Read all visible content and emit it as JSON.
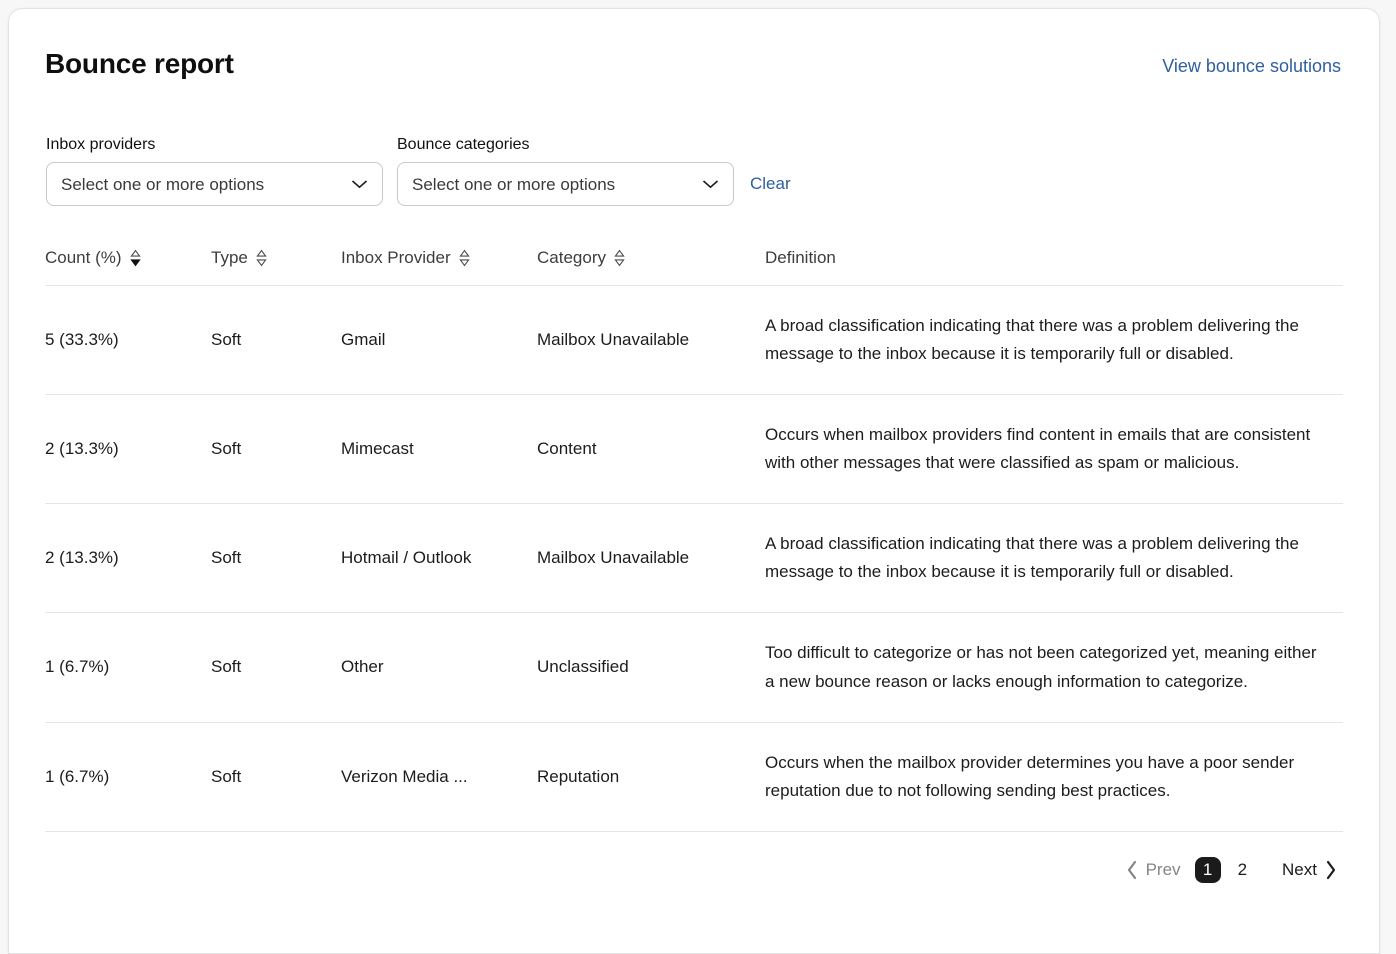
{
  "header": {
    "title": "Bounce report",
    "link_label": "View bounce solutions"
  },
  "filters": {
    "inbox_providers": {
      "label": "Inbox providers",
      "value": "Select one or more options",
      "placeholder": "Select one or more options"
    },
    "bounce_categories": {
      "label": "Bounce categories",
      "value": "Select one or more options",
      "placeholder": "Select one or more options"
    },
    "clear_label": "Clear"
  },
  "table": {
    "columns": [
      {
        "label": "Count (%)",
        "sortable": true,
        "sort_state": "desc"
      },
      {
        "label": "Type",
        "sortable": true,
        "sort_state": "none"
      },
      {
        "label": "Inbox Provider",
        "sortable": true,
        "sort_state": "none"
      },
      {
        "label": "Category",
        "sortable": true,
        "sort_state": "none"
      },
      {
        "label": "Definition",
        "sortable": false,
        "sort_state": "none"
      }
    ],
    "rows": [
      {
        "count": "5 (33.3%)",
        "type": "Soft",
        "provider": "Gmail",
        "category": "Mailbox Unavailable",
        "definition": "A broad classification indicating that there was a problem delivering the message to the inbox because it is temporarily full or disabled."
      },
      {
        "count": "2 (13.3%)",
        "type": "Soft",
        "provider": "Mimecast",
        "category": "Content",
        "definition": "Occurs when mailbox providers find content in emails that are consistent with other messages that were classified as spam or malicious."
      },
      {
        "count": "2 (13.3%)",
        "type": "Soft",
        "provider": "Hotmail / Outlook",
        "category": "Mailbox Unavailable",
        "definition": "A broad classification indicating that there was a problem delivering the message to the inbox because it is temporarily full or disabled."
      },
      {
        "count": "1 (6.7%)",
        "type": "Soft",
        "provider": "Other",
        "category": "Unclassified",
        "definition": "Too difficult to categorize or has not been categorized yet, meaning either a new bounce reason or lacks enough information to categorize."
      },
      {
        "count": "1 (6.7%)",
        "type": "Soft",
        "provider": "Verizon Media ...",
        "category": "Reputation",
        "definition": "Occurs when the mailbox provider determines you have a poor sender reputation due to not following sending best practices."
      }
    ]
  },
  "pagination": {
    "prev_label": "Prev",
    "next_label": "Next",
    "pages": [
      "1",
      "2"
    ],
    "current_page": "1"
  },
  "colors": {
    "link": "#2f5f9e",
    "active_page_bg": "#1b1b1b",
    "border": "#e4e4e4"
  }
}
